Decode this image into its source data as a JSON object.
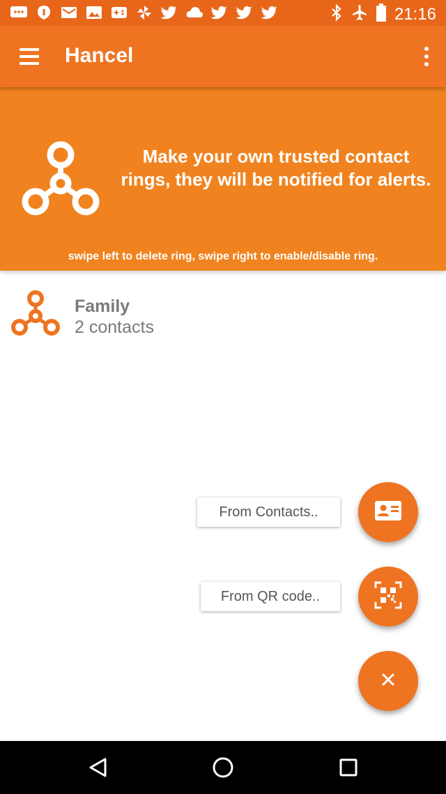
{
  "status_bar": {
    "time": "21:16",
    "notification_icons": [
      "messages-icon",
      "pushbullet-icon",
      "mail-icon",
      "image-icon",
      "gamepad-icon",
      "pinwheel-icon",
      "twitter-icon",
      "cloud-icon",
      "twitter-icon",
      "twitter-icon",
      "twitter-icon"
    ],
    "system_icons": [
      "bluetooth-icon",
      "airplane-mode-icon",
      "battery-icon"
    ]
  },
  "app_bar": {
    "title": "Hancel"
  },
  "banner": {
    "headline": "Make your own trusted contact rings, they will be notified for alerts.",
    "hint": "swipe left to delete ring, swipe right to enable/disable ring."
  },
  "rings": [
    {
      "name": "Family",
      "count_label": "2 contacts"
    }
  ],
  "fab_menu": {
    "from_contacts_label": "From Contacts..",
    "from_qr_label": "From QR code..",
    "contacts_icon": "contact-card-icon",
    "qr_icon": "qr-code-icon",
    "close_icon": "close-icon"
  },
  "colors": {
    "status_bar": "#e8661a",
    "app_bar": "#ee7422",
    "banner": "#f0831f",
    "accent": "#ee7422",
    "text_secondary": "#7a7a7a"
  }
}
